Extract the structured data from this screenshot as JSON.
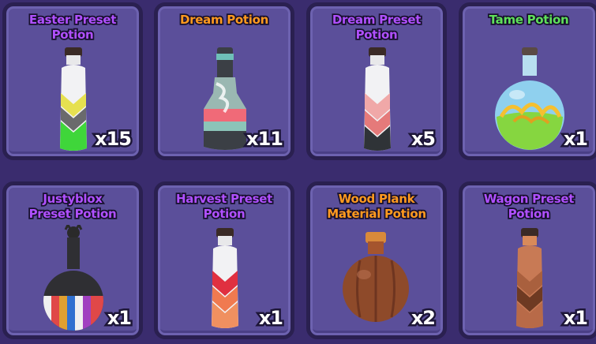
{
  "inventory": {
    "items": [
      {
        "name": "Easter Preset\nPotion",
        "count": "x15",
        "name_color": "#b050ff"
      },
      {
        "name": "Dream Potion",
        "count": "x11",
        "name_color": "#ff9a1f"
      },
      {
        "name": "Dream Preset\nPotion",
        "count": "x5",
        "name_color": "#b050ff"
      },
      {
        "name": "Tame Potion",
        "count": "x1",
        "name_color": "#5fe05a"
      },
      {
        "name": "Justyblox\nPreset Potion",
        "count": "x1",
        "name_color": "#b050ff"
      },
      {
        "name": "Harvest Preset\nPotion",
        "count": "x1",
        "name_color": "#b050ff"
      },
      {
        "name": "Wood Plank\nMaterial Potion",
        "count": "x2",
        "name_color": "#ff9a1f"
      },
      {
        "name": "Wagon Preset\nPotion",
        "count": "x1",
        "name_color": "#b050ff"
      }
    ],
    "icons": [
      "easter-bottle-icon",
      "dream-potion-bottle-icon",
      "dream-preset-bottle-icon",
      "tame-potion-flask-icon",
      "justyblox-flask-icon",
      "harvest-bottle-icon",
      "wood-plank-flask-icon",
      "wagon-bottle-icon"
    ]
  }
}
